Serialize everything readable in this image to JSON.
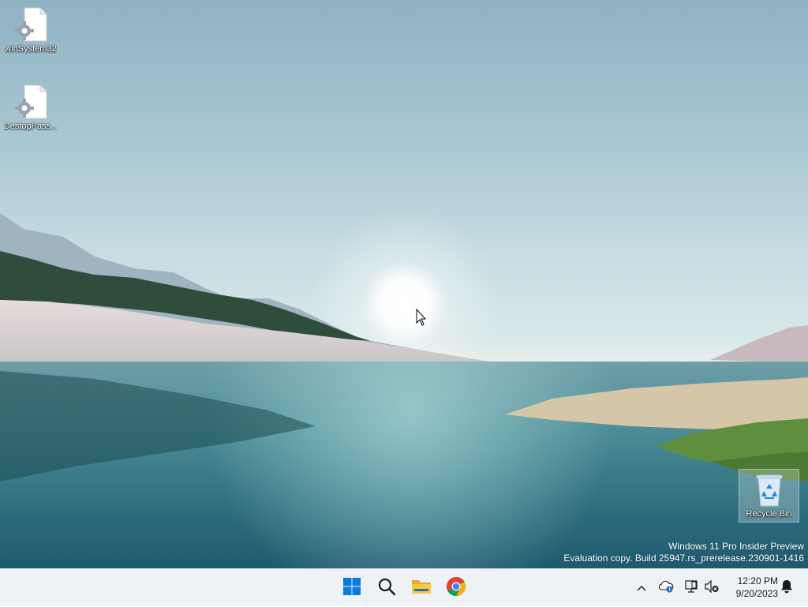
{
  "desktop": {
    "icons": [
      {
        "name": "winSystem32",
        "icon": "settings-file-icon"
      },
      {
        "name": "DestopPass...",
        "icon": "settings-file-icon"
      }
    ],
    "recycle_bin": {
      "label": "Recycle Bin",
      "icon": "recycle-bin-icon"
    },
    "watermark": {
      "line1": "Windows 11 Pro Insider Preview",
      "line2": "Evaluation copy. Build 25947.rs_prerelease.230901-1416"
    }
  },
  "taskbar": {
    "apps": [
      {
        "name": "Start",
        "icon": "windows-logo-icon"
      },
      {
        "name": "Search",
        "icon": "search-icon"
      },
      {
        "name": "File Explorer",
        "icon": "folder-icon"
      },
      {
        "name": "Google Chrome",
        "icon": "chrome-icon"
      }
    ],
    "tray": {
      "chevron_icon": "chevron-up-icon",
      "cloud_icon": "onedrive-icon",
      "network_icon": "network-icon",
      "volume_icon": "volume-muted-icon",
      "bell_icon": "notification-bell-icon"
    },
    "clock": {
      "time": "12:20 PM",
      "date": "9/20/2023"
    }
  },
  "colors": {
    "taskbar_bg": "#eef1f6",
    "windows_blue": "#0a7ae0",
    "folder_yellow": "#f4c430"
  }
}
